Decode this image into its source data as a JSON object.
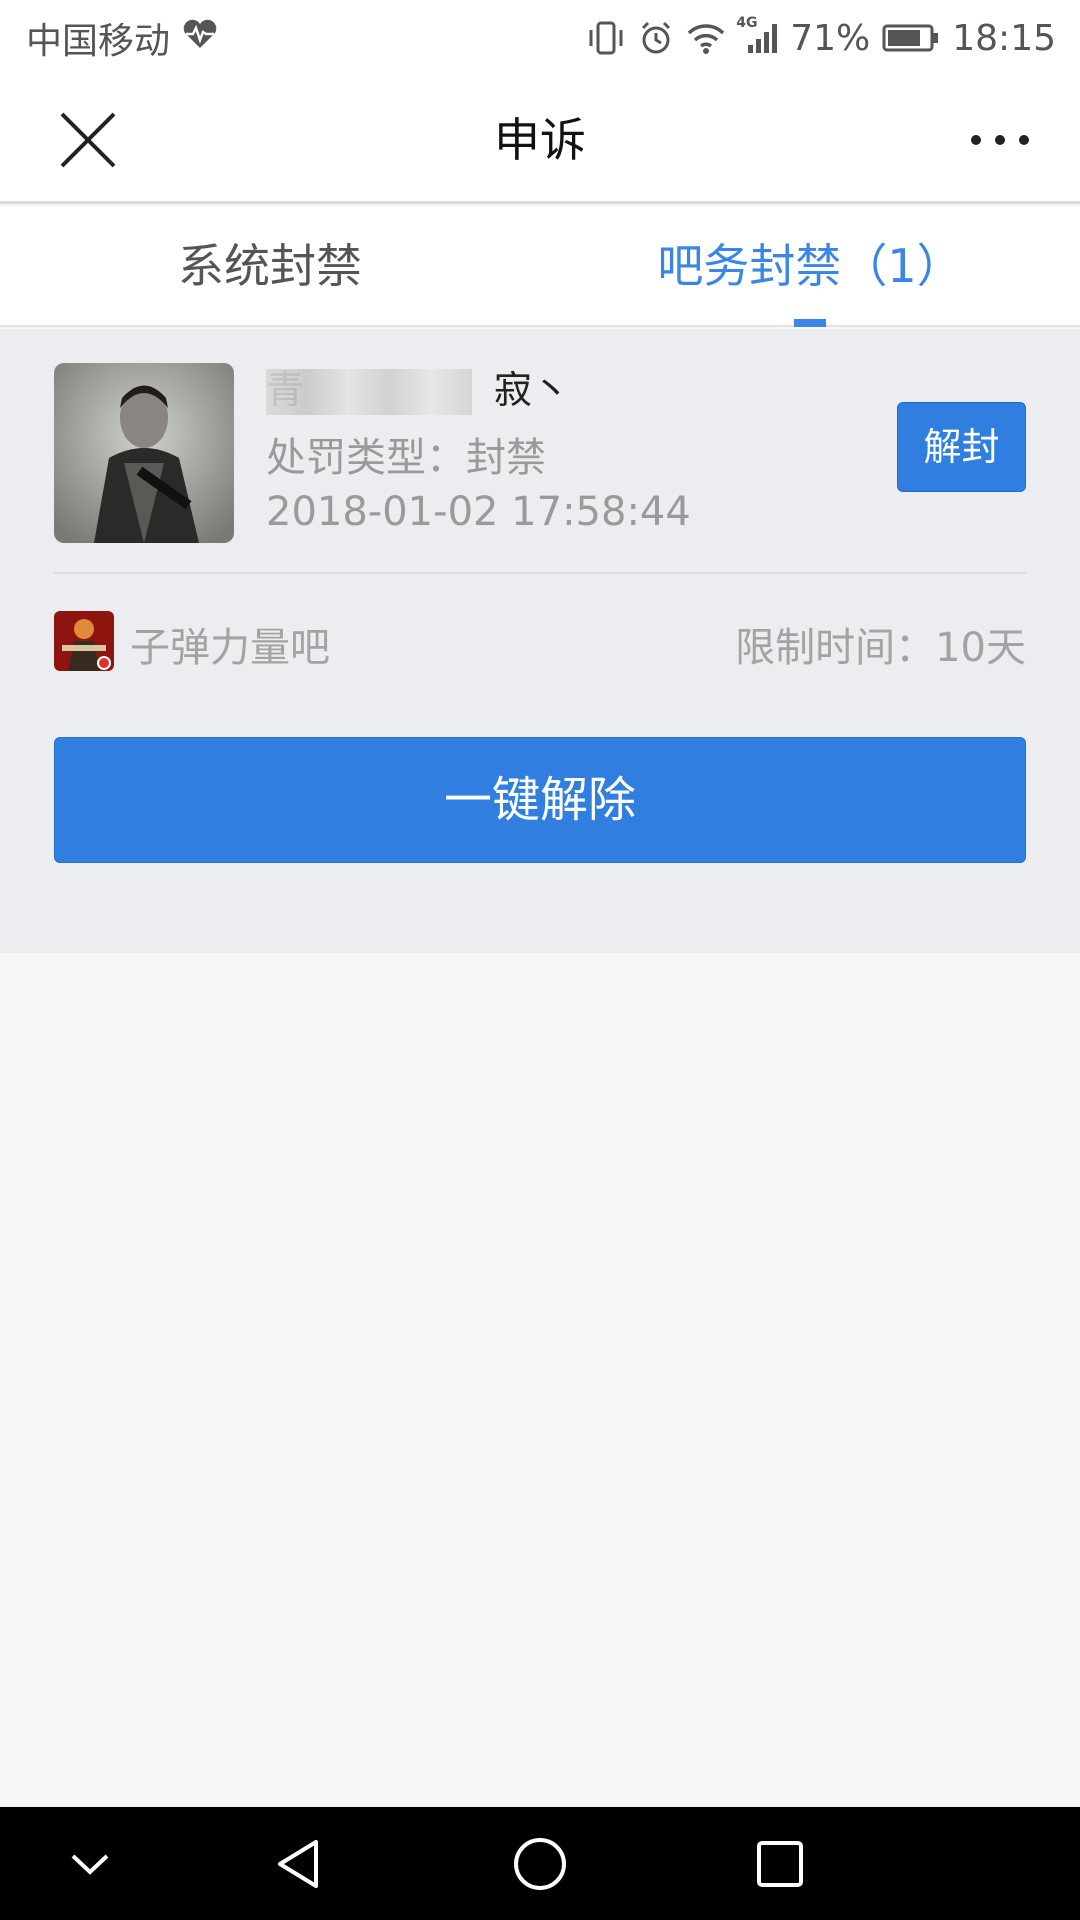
{
  "status_bar": {
    "carrier": "中国移动",
    "network_label": "4G",
    "battery_percent": "71%",
    "time": "18:15",
    "icons": [
      "heart-pulse-icon",
      "vibrate-icon",
      "alarm-icon",
      "wifi-icon",
      "signal-icon",
      "battery-icon"
    ]
  },
  "nav": {
    "title": "申诉",
    "close_icon": "close-icon",
    "more_icon": "more-icon"
  },
  "tabs": [
    {
      "label": "系统封禁",
      "active": false
    },
    {
      "label": "吧务封禁（1）",
      "active": true
    }
  ],
  "ban_item": {
    "username": "青　　　　　寂丶",
    "punish_type": "处罚类型：封禁",
    "time": "2018-01-02 17:58:44",
    "unban_label": "解封",
    "forum_name": "子弹力量吧",
    "limit_time": "限制时间：10天"
  },
  "actions": {
    "one_click_label": "一键解除"
  },
  "colors": {
    "accent": "#2f7ee0",
    "tab_active": "#3a86e6",
    "card_bg": "#ebedf0",
    "page_bg": "#f6f7f9"
  },
  "system_nav": {
    "icons": [
      "chevron-down-icon",
      "back-icon",
      "home-icon",
      "recents-icon"
    ]
  }
}
